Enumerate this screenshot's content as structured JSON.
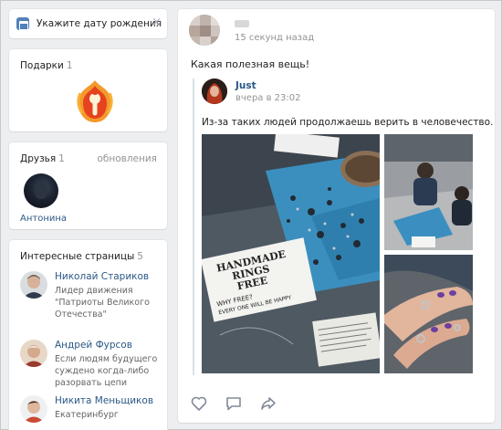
{
  "birthday_prompt": {
    "label": "Укажите дату рождения",
    "close": "×"
  },
  "gifts": {
    "title": "Подарки",
    "count": "1"
  },
  "friends": {
    "title": "Друзья",
    "count": "1",
    "updates_link": "обновления",
    "items": [
      {
        "name": "Антонина"
      }
    ]
  },
  "interesting_pages": {
    "title": "Интересные страницы",
    "count": "5",
    "items": [
      {
        "name": "Николай Стариков",
        "description": "Лидер движения \"Патриоты Великого Отечества\""
      },
      {
        "name": "Андрей Фурсов",
        "description": "Если людям будущего суждено когда-либо разорвать цепи"
      },
      {
        "name": "Никита Меньщиков",
        "description": "Екатеринбург"
      }
    ]
  },
  "post": {
    "time": "15 секунд назад",
    "text": "Какая полезная вещь!",
    "repost": {
      "author": "Just",
      "time": "вчера в 23:02",
      "text": "Из-за таких людей продолжаешь верить в человечество."
    },
    "photo_sign": {
      "title_line1": "HANDMADE",
      "title_line2": "RINGS",
      "title_line3": "FREE",
      "subtitle_line1": "WHY FREE?",
      "subtitle_line2": "EVERY ONE WILL BE HAPPY"
    },
    "actions": {
      "like": "heart-icon",
      "comment": "comment-icon",
      "share": "share-icon"
    }
  },
  "colors": {
    "background": "#edeef0",
    "link": "#2a5885",
    "accent": "#5181b8",
    "muted": "#939393"
  }
}
